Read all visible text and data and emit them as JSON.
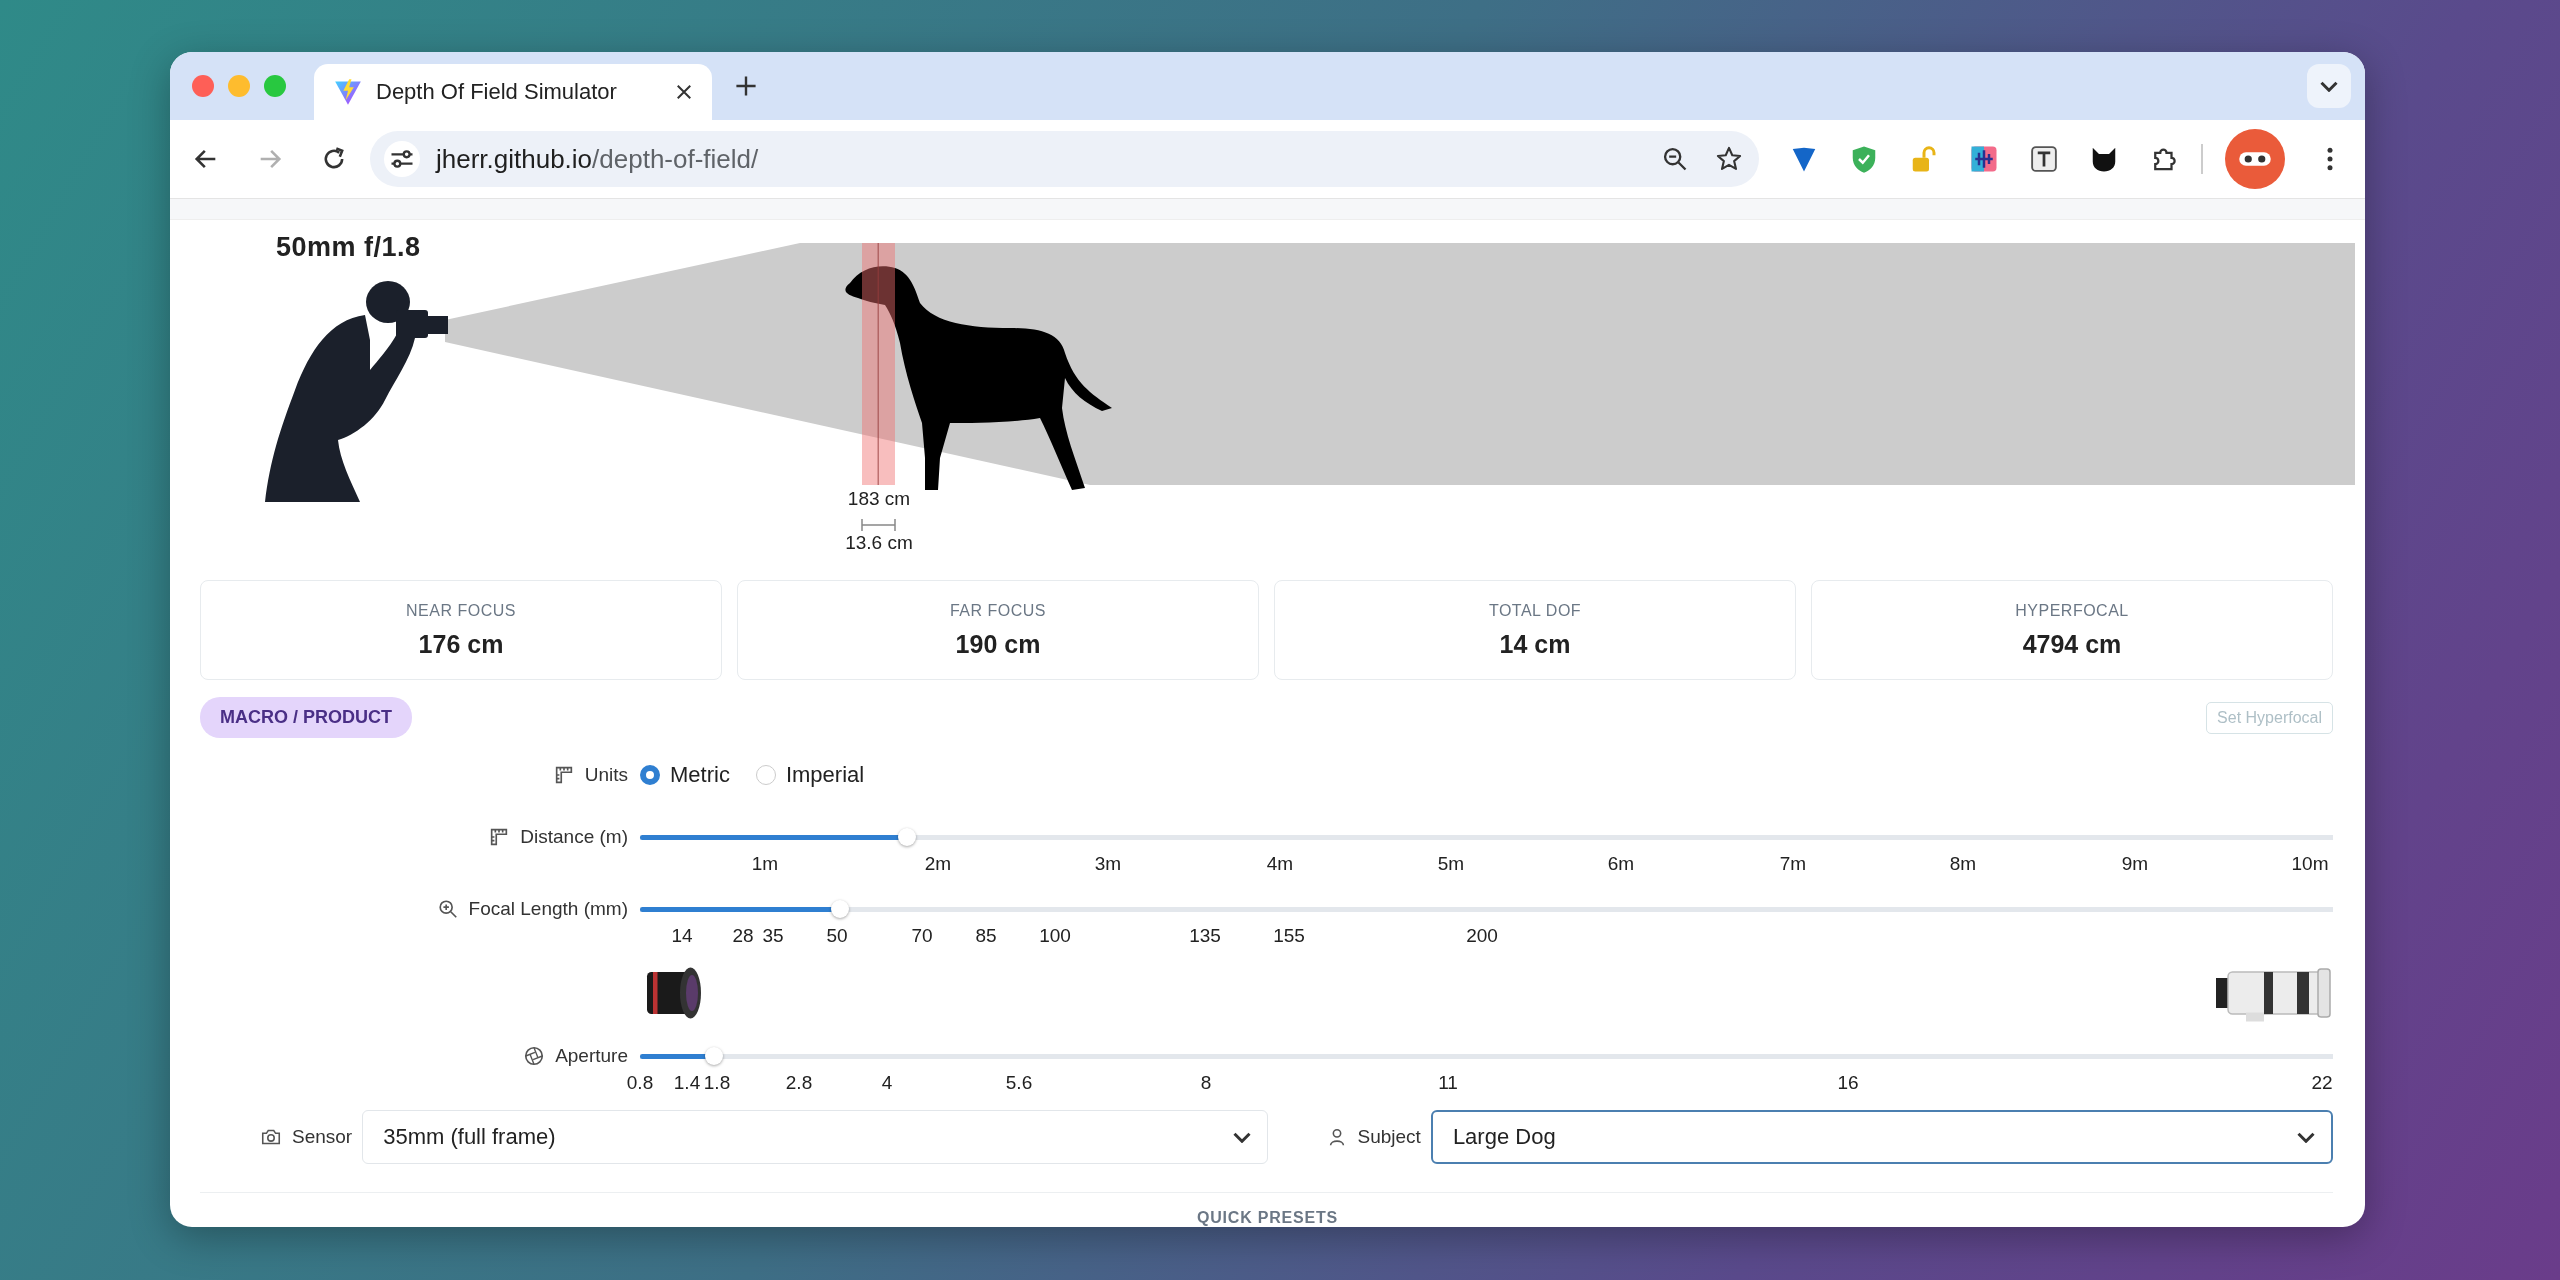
{
  "browser": {
    "tabs": [
      {
        "title": "Depth Of Field Simulator",
        "selected": true
      }
    ],
    "nav": [
      {
        "kind": "back",
        "disabled": false
      },
      {
        "kind": "forward",
        "disabled": true
      },
      {
        "kind": "reload",
        "disabled": false
      }
    ],
    "address": {
      "host": "jherr.github.io",
      "path": "/depth-of-field/"
    }
  },
  "scene": {
    "lens_label": "50mm f/1.8",
    "focus_distance": "183 cm",
    "dof_width": "13.6 cm"
  },
  "stats": [
    {
      "label": "NEAR FOCUS",
      "value": "176 cm"
    },
    {
      "label": "FAR FOCUS",
      "value": "190 cm"
    },
    {
      "label": "TOTAL DOF",
      "value": "14 cm"
    },
    {
      "label": "HYPERFOCAL",
      "value": "4794 cm"
    }
  ],
  "badge": "MACRO / PRODUCT",
  "set_hyperfocal": {
    "label": "Set Hyperfocal",
    "disabled": true
  },
  "units": {
    "label": "Units",
    "options": [
      {
        "label": "Metric",
        "selected": true
      },
      {
        "label": "Imperial",
        "selected": false
      }
    ]
  },
  "sliders": [
    {
      "kind": "distance",
      "label": "Distance (m)",
      "level": 0.158,
      "ticks": [
        "1m",
        "2m",
        "3m",
        "4m",
        "5m",
        "6m",
        "7m",
        "8m",
        "9m",
        "10m"
      ]
    },
    {
      "kind": "focal",
      "label": "Focal Length (mm)",
      "level": 0.118,
      "ticks": [
        "14",
        "28",
        "35",
        "50",
        "70",
        "85",
        "100",
        "135",
        "155",
        "200"
      ]
    },
    {
      "kind": "aperture",
      "label": "Aperture",
      "level": 0.044,
      "ticks": [
        "0.8",
        "1.4",
        "1.8",
        "2.8",
        "4",
        "5.6",
        "8",
        "11",
        "16",
        "22"
      ]
    }
  ],
  "selects": [
    {
      "kind": "sensor",
      "label": "Sensor",
      "value": "35mm (full frame)",
      "focused": false
    },
    {
      "kind": "subject",
      "label": "Subject",
      "value": "Large Dog",
      "focused": true
    }
  ],
  "presets_heading": "QUICK PRESETS"
}
